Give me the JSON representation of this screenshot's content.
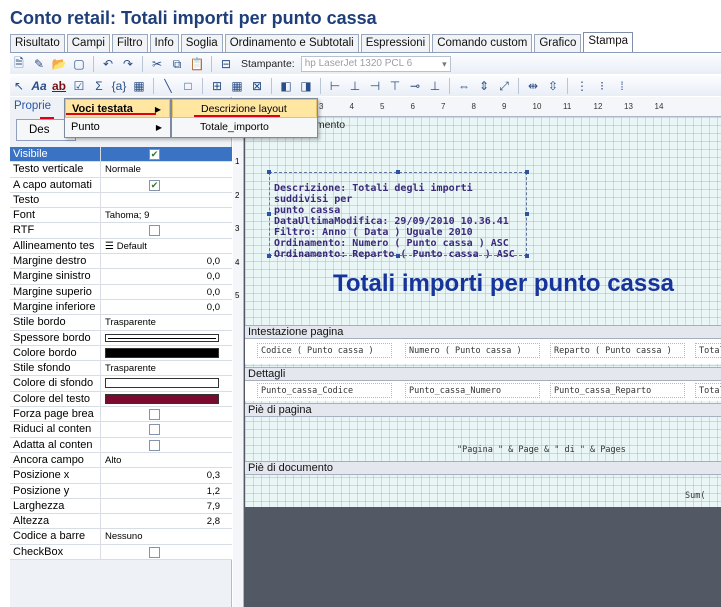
{
  "window": {
    "title": "Conto retail: Totali importi per punto cassa"
  },
  "tabs": [
    {
      "label": "Risultato"
    },
    {
      "label": "Campi"
    },
    {
      "label": "Filtro"
    },
    {
      "label": "Info"
    },
    {
      "label": "Soglia"
    },
    {
      "label": "Ordinamento e Subtotali"
    },
    {
      "label": "Espressioni"
    },
    {
      "label": "Comando custom"
    },
    {
      "label": "Grafico"
    },
    {
      "label": "Stampa"
    }
  ],
  "toolbar": {
    "printer_label": "Stampante:",
    "printer_value": "hp LaserJet 1320 PCL 6"
  },
  "panel": {
    "header": "Proprie",
    "des_button": "Des",
    "properties": [
      {
        "name": "Visibile",
        "type": "check",
        "checked": true
      },
      {
        "name": "Testo verticale",
        "value": "Normale"
      },
      {
        "name": "A capo automati",
        "type": "check",
        "checked": true
      },
      {
        "name": "Testo",
        "value": ""
      },
      {
        "name": "Font",
        "value": "Tahoma; 9"
      },
      {
        "name": "RTF",
        "type": "check",
        "checked": false
      },
      {
        "name": "Allineamento tes",
        "value": "Default"
      },
      {
        "name": "Margine destro",
        "value": "0,0",
        "num": true
      },
      {
        "name": "Margine sinistro",
        "value": "0,0",
        "num": true
      },
      {
        "name": "Margine superio",
        "value": "0,0",
        "num": true
      },
      {
        "name": "Margine inferiore",
        "value": "0,0",
        "num": true
      },
      {
        "name": "Stile bordo",
        "value": "Trasparente"
      },
      {
        "name": "Spessore bordo",
        "type": "line"
      },
      {
        "name": "Colore bordo",
        "type": "color",
        "color": "#000000"
      },
      {
        "name": "Stile sfondo",
        "value": "Trasparente"
      },
      {
        "name": "Colore di sfondo",
        "type": "color",
        "color": "#ffffff"
      },
      {
        "name": "Colore del testo",
        "type": "color",
        "color": "#7a0a30"
      },
      {
        "name": "Forza page brea",
        "type": "check",
        "checked": false
      },
      {
        "name": "Riduci al conten",
        "type": "check",
        "checked": false
      },
      {
        "name": "Adatta al conten",
        "type": "check",
        "checked": false
      },
      {
        "name": "Ancora campo",
        "value": "Alto"
      },
      {
        "name": "Posizione x",
        "value": "0,3",
        "num": true
      },
      {
        "name": "Posizione y",
        "value": "1,2",
        "num": true
      },
      {
        "name": "Larghezza",
        "value": "7,9",
        "num": true
      },
      {
        "name": "Altezza",
        "value": "2,8",
        "num": true
      },
      {
        "name": "Codice a barre",
        "value": "Nessuno"
      },
      {
        "name": "CheckBox",
        "type": "check",
        "checked": false
      }
    ]
  },
  "menu": {
    "items": [
      {
        "label": "Voci testata"
      },
      {
        "label": "Punto"
      }
    ],
    "submenu": [
      {
        "label": "Descrizione layout"
      },
      {
        "label": "Totale_importo"
      }
    ]
  },
  "design": {
    "ruler_marks": [
      "3",
      "4",
      "5",
      "6",
      "7",
      "8",
      "9",
      "10",
      "11",
      "12",
      "13",
      "14"
    ],
    "vruler_marks": [
      "1",
      "2",
      "3",
      "4",
      "5"
    ],
    "doc_header": "ocumento",
    "desc_lines": [
      "Descrizione: Totali degli importi suddivisi per",
      "punto cassa",
      "DataUltimaModifica: 29/09/2010 10.36.41",
      "Filtro: Anno ( Data ) Uguale 2010",
      "Ordinamento: Numero ( Punto cassa ) ASC",
      "Ordinamento: Reparto ( Punto cassa ) ASC"
    ],
    "big_title": "Totali importi per punto cassa",
    "bands": {
      "page_header": "Intestazione pagina",
      "details": "Dettagli",
      "page_footer": "Piè di pagina",
      "doc_footer": "Piè di documento"
    },
    "header_fields": [
      "Codice ( Punto cassa )",
      "Numero ( Punto cassa )",
      "Reparto ( Punto cassa )",
      "Totale"
    ],
    "detail_fields": [
      "Punto_cassa_Codice",
      "Punto_cassa_Numero",
      "Punto_cassa_Reparto",
      "Totale_"
    ],
    "page_expr": "\"Pagina \" & Page & \" di \" & Pages",
    "sum_field": "Sum("
  }
}
